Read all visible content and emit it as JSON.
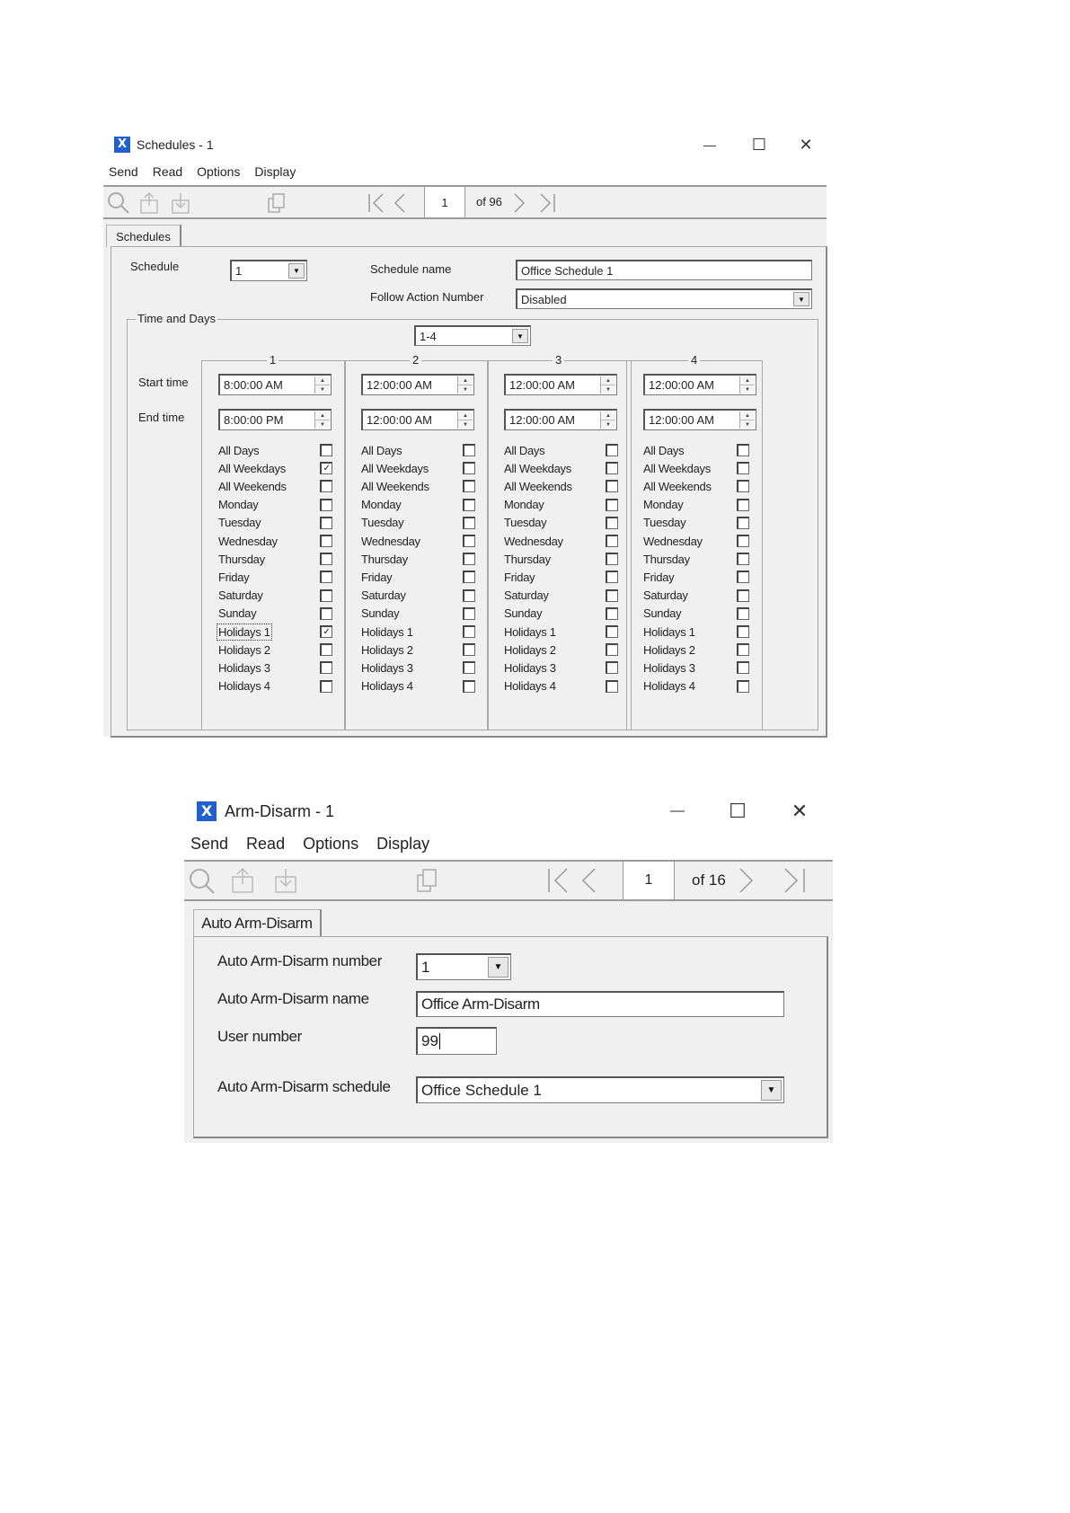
{
  "schedules_window": {
    "title": "Schedules - 1",
    "app_icon": "X",
    "window_controls": {
      "minimize": "—",
      "maximize": "☐",
      "close": "✕"
    },
    "menu": [
      "Send",
      "Read",
      "Options",
      "Display"
    ],
    "toolbar": {
      "icons": [
        "search-icon",
        "upload-icon",
        "download-icon",
        "copy-icon"
      ],
      "page_current": "1",
      "page_of": "of 96"
    },
    "tab_label": "Schedules",
    "schedule_label": "Schedule",
    "schedule_value": "1",
    "schedule_name_label": "Schedule name",
    "schedule_name_value": "Office Schedule 1",
    "follow_action_label": "Follow Action Number",
    "follow_action_value": "Disabled",
    "time_days_label": "Time and Days",
    "range_value": "1-4",
    "start_time_label": "Start time",
    "end_time_label": "End time",
    "columns": [
      {
        "number": "1",
        "start": "8:00:00 AM",
        "end": "8:00:00 PM",
        "days": [
          {
            "label": "All Days",
            "checked": false
          },
          {
            "label": "All Weekdays",
            "checked": true
          },
          {
            "label": "All Weekends",
            "checked": false
          },
          {
            "label": "Monday",
            "checked": false
          },
          {
            "label": "Tuesday",
            "checked": false
          },
          {
            "label": "Wednesday",
            "checked": false
          },
          {
            "label": "Thursday",
            "checked": false
          },
          {
            "label": "Friday",
            "checked": false
          },
          {
            "label": "Saturday",
            "checked": false
          },
          {
            "label": "Sunday",
            "checked": false
          },
          {
            "label": "Holidays 1",
            "checked": true,
            "focused": true
          },
          {
            "label": "Holidays 2",
            "checked": false
          },
          {
            "label": "Holidays 3",
            "checked": false
          },
          {
            "label": "Holidays 4",
            "checked": false
          }
        ]
      },
      {
        "number": "2",
        "start": "12:00:00 AM",
        "end": "12:00:00 AM",
        "days": [
          {
            "label": "All Days",
            "checked": false
          },
          {
            "label": "All Weekdays",
            "checked": false
          },
          {
            "label": "All Weekends",
            "checked": false
          },
          {
            "label": "Monday",
            "checked": false
          },
          {
            "label": "Tuesday",
            "checked": false
          },
          {
            "label": "Wednesday",
            "checked": false
          },
          {
            "label": "Thursday",
            "checked": false
          },
          {
            "label": "Friday",
            "checked": false
          },
          {
            "label": "Saturday",
            "checked": false
          },
          {
            "label": "Sunday",
            "checked": false
          },
          {
            "label": "Holidays 1",
            "checked": false
          },
          {
            "label": "Holidays 2",
            "checked": false
          },
          {
            "label": "Holidays 3",
            "checked": false
          },
          {
            "label": "Holidays 4",
            "checked": false
          }
        ]
      },
      {
        "number": "3",
        "start": "12:00:00 AM",
        "end": "12:00:00 AM",
        "days": [
          {
            "label": "All Days",
            "checked": false
          },
          {
            "label": "All Weekdays",
            "checked": false
          },
          {
            "label": "All Weekends",
            "checked": false
          },
          {
            "label": "Monday",
            "checked": false
          },
          {
            "label": "Tuesday",
            "checked": false
          },
          {
            "label": "Wednesday",
            "checked": false
          },
          {
            "label": "Thursday",
            "checked": false
          },
          {
            "label": "Friday",
            "checked": false
          },
          {
            "label": "Saturday",
            "checked": false
          },
          {
            "label": "Sunday",
            "checked": false
          },
          {
            "label": "Holidays 1",
            "checked": false
          },
          {
            "label": "Holidays 2",
            "checked": false
          },
          {
            "label": "Holidays 3",
            "checked": false
          },
          {
            "label": "Holidays 4",
            "checked": false
          }
        ]
      },
      {
        "number": "4",
        "start": "12:00:00 AM",
        "end": "12:00:00 AM",
        "days": [
          {
            "label": "All Days",
            "checked": false
          },
          {
            "label": "All Weekdays",
            "checked": false
          },
          {
            "label": "All Weekends",
            "checked": false
          },
          {
            "label": "Monday",
            "checked": false
          },
          {
            "label": "Tuesday",
            "checked": false
          },
          {
            "label": "Wednesday",
            "checked": false
          },
          {
            "label": "Thursday",
            "checked": false
          },
          {
            "label": "Friday",
            "checked": false
          },
          {
            "label": "Saturday",
            "checked": false
          },
          {
            "label": "Sunday",
            "checked": false
          },
          {
            "label": "Holidays 1",
            "checked": false
          },
          {
            "label": "Holidays 2",
            "checked": false
          },
          {
            "label": "Holidays 3",
            "checked": false
          },
          {
            "label": "Holidays 4",
            "checked": false
          }
        ]
      }
    ]
  },
  "arm_window": {
    "title": "Arm-Disarm - 1",
    "app_icon": "X",
    "window_controls": {
      "minimize": "—",
      "maximize": "☐",
      "close": "✕"
    },
    "menu": [
      "Send",
      "Read",
      "Options",
      "Display"
    ],
    "toolbar": {
      "icons": [
        "search-icon",
        "upload-icon",
        "download-icon",
        "copy-icon"
      ],
      "page_current": "1",
      "page_of": "of 16"
    },
    "tab_label": "Auto Arm-Disarm",
    "number_label": "Auto Arm-Disarm number",
    "number_value": "1",
    "name_label": "Auto Arm-Disarm name",
    "name_value": "Office Arm-Disarm",
    "user_label": "User number",
    "user_value": "99",
    "schedule_label": "Auto Arm-Disarm schedule",
    "schedule_value": "Office Schedule 1"
  },
  "colors": {
    "accent": "#1f5fcf",
    "pane": "#f0f0f0",
    "border": "#a8a8a8"
  }
}
